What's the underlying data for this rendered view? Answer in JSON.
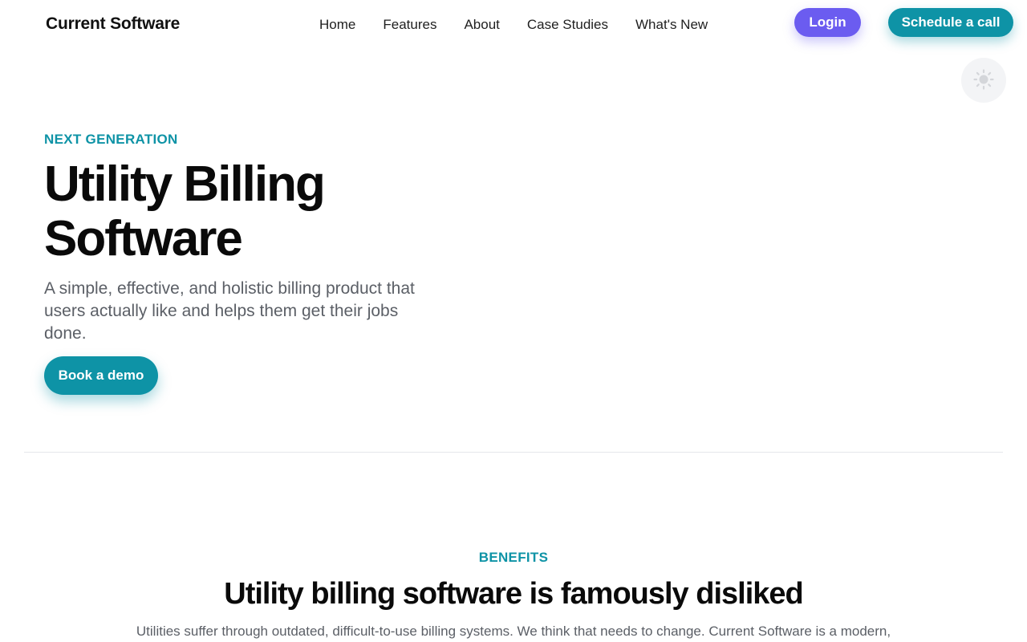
{
  "header": {
    "brand": "Current Software",
    "nav": [
      "Home",
      "Features",
      "About",
      "Case Studies",
      "What's New"
    ],
    "login_label": "Login",
    "schedule_label": "Schedule a call",
    "theme_icon": "sun-icon"
  },
  "hero": {
    "eyebrow": "NEXT GENERATION",
    "title": "Utility Billing Software",
    "subtitle": "A simple, effective, and holistic billing product that users actually like and helps them get their jobs done.",
    "cta_label": "Book a demo"
  },
  "benefits": {
    "eyebrow": "BENEFITS",
    "title": "Utility billing software is famously disliked",
    "text": "Utilities suffer through outdated, difficult-to-use billing systems. We think that needs to change. Current Software is a modern,"
  },
  "colors": {
    "accent_teal": "#0e93a6",
    "login_purple": "#6b5cf0",
    "text_muted": "#5b5f66"
  }
}
